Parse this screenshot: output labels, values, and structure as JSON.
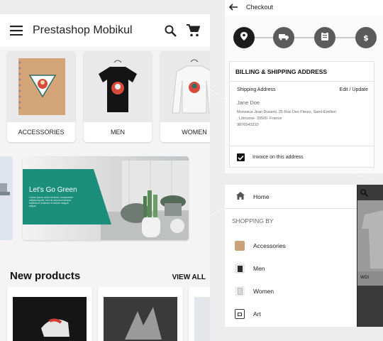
{
  "home": {
    "app_title": "Prestashop Mobikul",
    "categories": [
      {
        "label": "ACCESSORIES"
      },
      {
        "label": "MEN"
      },
      {
        "label": "WOMEN"
      }
    ],
    "banner": {
      "heading": "Let's Go Green",
      "body": "Lorem ipsum dolor sit amet, consectetur adipiscing elit, sed do eiusmod tempor incididunt ut labore et dolore magna aliqua."
    },
    "new_products_title": "New products",
    "view_all_label": "VIEW ALL"
  },
  "checkout": {
    "title": "Checkout",
    "section_title": "BILLING & SHIPPING ADDRESS",
    "shipping_label": "Shipping Address",
    "edit_label": "Edit / Update",
    "name": "Jane Doe",
    "address_line1": "Monsieur Jean Durand, 25 Rue Des Fleurs, Saint-Émilion",
    "address_line2": ", Libourne- 33500, France",
    "phone": "9876543210",
    "invoice_label": "Invoice on this address"
  },
  "drawer": {
    "home_label": "Home",
    "section_label": "SHOPPING BY",
    "items": [
      {
        "label": "Accessories",
        "thumb": "#c9a27a"
      },
      {
        "label": "Men",
        "thumb": "#2b2b2b"
      },
      {
        "label": "Women",
        "thumb": "#d8d8d8"
      },
      {
        "label": "Art",
        "thumb": "#ffffff"
      }
    ],
    "behind_label": "WOI"
  },
  "colors": {
    "accent_green": "#1b8f7b",
    "step_active": "#1c1c1c",
    "step_inactive": "#5b5b5b"
  },
  "icons": [
    "menu-icon",
    "search-icon",
    "cart-icon",
    "back-arrow-icon",
    "location-pin-icon",
    "truck-icon",
    "clipboard-icon",
    "dollar-icon",
    "checkbox-checked-icon",
    "home-icon"
  ]
}
